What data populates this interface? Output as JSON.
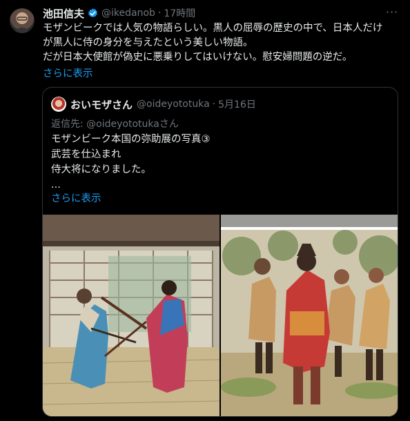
{
  "tweet": {
    "author_name": "池田信夫",
    "handle": "@ikedanob",
    "separator": "·",
    "time": "17時間",
    "more_icon": "ellipsis-icon",
    "lines": [
      "モザンビークでは人気の物語らしい。黒人の屈辱の歴史の中で、日本人だけ",
      "が黒人に侍の身分を与えたという美しい物語。",
      "だが日本大使館が偽史に悪乗りしてはいけない。慰安婦問題の逆だ。"
    ],
    "show_more": "さらに表示"
  },
  "quote": {
    "author_name": "おいモザさん",
    "handle": "@oideyototuka",
    "separator": "·",
    "date": "5月16日",
    "reply_prefix": "返信先: ",
    "reply_handle": "@oideyototuka",
    "reply_suffix": "さん",
    "lines": [
      "モザンビーク本国の弥助展の写真③",
      "武芸を仕込まれ",
      "侍大将になりました。",
      "..."
    ],
    "show_more": "さらに表示"
  },
  "colors": {
    "background": "#000000",
    "text": "#e7e9ea",
    "secondary": "#71767b",
    "link": "#1d9bf0",
    "border": "#2f3336"
  }
}
